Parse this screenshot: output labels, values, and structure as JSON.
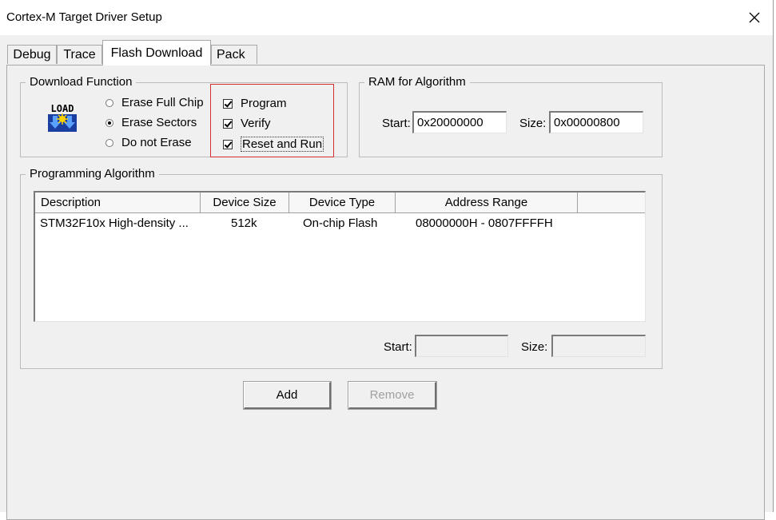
{
  "window": {
    "title": "Cortex-M Target Driver Setup"
  },
  "tabs": [
    {
      "label": "Debug"
    },
    {
      "label": "Trace"
    },
    {
      "label": "Flash Download"
    },
    {
      "label": "Pack"
    }
  ],
  "download_function": {
    "group_title": "Download Function",
    "icon": "load-icon",
    "radios": [
      {
        "label": "Erase Full Chip",
        "checked": false
      },
      {
        "label": "Erase Sectors",
        "checked": true
      },
      {
        "label": "Do not Erase",
        "checked": false
      }
    ],
    "checks": [
      {
        "label": "Program",
        "checked": true
      },
      {
        "label": "Verify",
        "checked": true
      },
      {
        "label": "Reset and Run",
        "checked": true
      }
    ]
  },
  "ram_for_algorithm": {
    "group_title": "RAM for Algorithm",
    "start_label": "Start:",
    "start_value": "0x20000000",
    "size_label": "Size:",
    "size_value": "0x00000800"
  },
  "programming_algorithm": {
    "group_title": "Programming Algorithm",
    "columns": [
      "Description",
      "Device Size",
      "Device Type",
      "Address Range"
    ],
    "rows": [
      {
        "description": "STM32F10x High-density ...",
        "device_size": "512k",
        "device_type": "On-chip Flash",
        "address_range": "08000000H - 0807FFFFH"
      }
    ],
    "start_label": "Start:",
    "start_value": "",
    "size_label": "Size:",
    "size_value": ""
  },
  "buttons": {
    "add_label": "Add",
    "remove_label": "Remove"
  },
  "colors": {
    "highlight_border": "#d43030"
  }
}
